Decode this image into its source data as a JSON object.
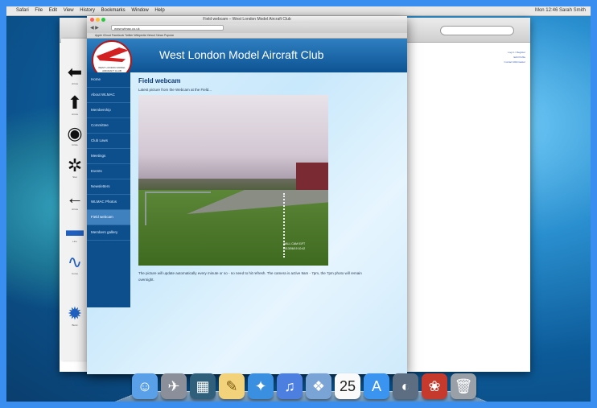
{
  "menubar": {
    "items": [
      "Safari",
      "File",
      "Edit",
      "View",
      "History",
      "Bookmarks",
      "Window",
      "Help"
    ],
    "status": "Mon 12:46  Sarah Smith"
  },
  "browser": {
    "title": "Field webcam – West London Model Aircraft Club",
    "url": "www.wlmac.co.uk",
    "bookmarks": "Apple  iCloud  Facebook  Twitter  Wikipedia  Yahoo!  News  Popular"
  },
  "site": {
    "logo_text": "WEST LONDON MODEL AIRCRAFT CLUB",
    "title": "West London Model Aircraft Club",
    "nav": [
      {
        "label": "Home"
      },
      {
        "label": "About WLMAC"
      },
      {
        "label": "Membership"
      },
      {
        "label": "Committee"
      },
      {
        "label": "Club Laws"
      },
      {
        "label": "Meetings"
      },
      {
        "label": "Events"
      },
      {
        "label": "Newsletters"
      },
      {
        "label": "WLMAC Photos"
      },
      {
        "label": "Field webcam",
        "active": true
      },
      {
        "label": "Members gallery"
      }
    ],
    "page_heading": "Field webcam",
    "lead": "Latest picture from the Webcam at the Field...",
    "webcam_stamp_line1": "WALL CAM 01FT",
    "webcam_stamp_line2": "2013/06/19  10:42",
    "caption": "The picture will update automatically every minute or so - no need to hit refresh. The camera is active 9am - 7pm, the 7pm photo will remain overnight."
  },
  "background_window": {
    "links": [
      "Log in / Register",
      "Edit Profile",
      "Contact Webmaster"
    ]
  },
  "palette_labels": [
    "Arrow",
    "Arrow",
    "Circle",
    "Star",
    "Arrow",
    "Line",
    "Curve",
    "Burst"
  ],
  "dock": [
    "Finder",
    "Launchpad",
    "Mission Control",
    "Notes",
    "Safari",
    "iTunes",
    "Preview",
    "Calendar",
    "App Store",
    "FaceTime",
    "Photo Booth",
    "Trash"
  ],
  "colors": {
    "header_blue": "#0d5393",
    "nav_blue": "#0d4f8c",
    "heading_blue": "#0d3c7a",
    "frame_blue": "#3a8ef0"
  }
}
